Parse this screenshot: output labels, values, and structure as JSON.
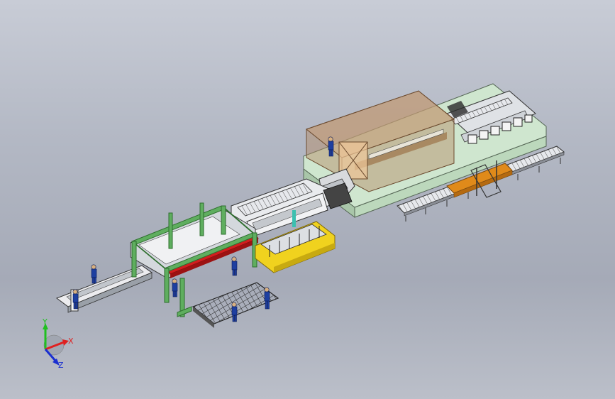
{
  "triad": {
    "x_label": "X",
    "y_label": "Y",
    "z_label": "Z",
    "colors": {
      "x": "#e02020",
      "y": "#20c020",
      "z": "#1a2fd0"
    }
  },
  "colors": {
    "background_top": "#c8ccd6",
    "background_bottom": "#a5aab7",
    "base_platform": "#cfe6cf",
    "enclosure": "#b38a62",
    "gantry_frame": "#5fae5f",
    "red_beam": "#d21e1e",
    "yellow_station": "#f0d21e",
    "orange_conveyor": "#e08a1a",
    "operator_figure": "#1e3fa0"
  }
}
